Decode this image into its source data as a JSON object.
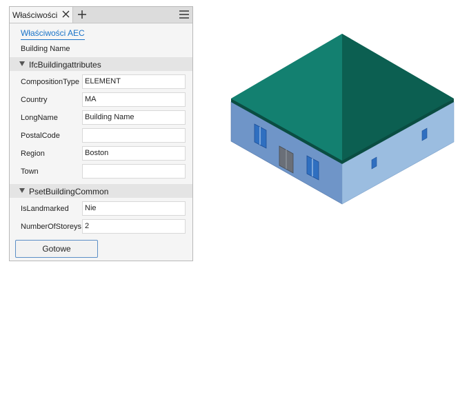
{
  "panel": {
    "tab_label": "Właściwości",
    "aec_link": "Właściwości AEC",
    "element_name": "Building Name",
    "sections": [
      {
        "title": "IfcBuildingattributes",
        "properties": [
          {
            "label": "CompositionType",
            "value": "ELEMENT"
          },
          {
            "label": "Country",
            "value": "MA"
          },
          {
            "label": "LongName",
            "value": "Building Name"
          },
          {
            "label": "PostalCode",
            "value": ""
          },
          {
            "label": "Region",
            "value": "Boston"
          },
          {
            "label": "Town",
            "value": ""
          }
        ]
      },
      {
        "title": "PsetBuildingCommon",
        "properties": [
          {
            "label": "IsLandmarked",
            "value": "Nie"
          },
          {
            "label": "NumberOfStoreys",
            "value": "2"
          }
        ]
      }
    ],
    "done_button": "Gotowe"
  },
  "colors": {
    "roof": "#0f6a5a",
    "wall_left": "#6f95c8",
    "wall_right": "#9bbde0",
    "window": "#2f6fc0",
    "link": "#1a73c8"
  }
}
